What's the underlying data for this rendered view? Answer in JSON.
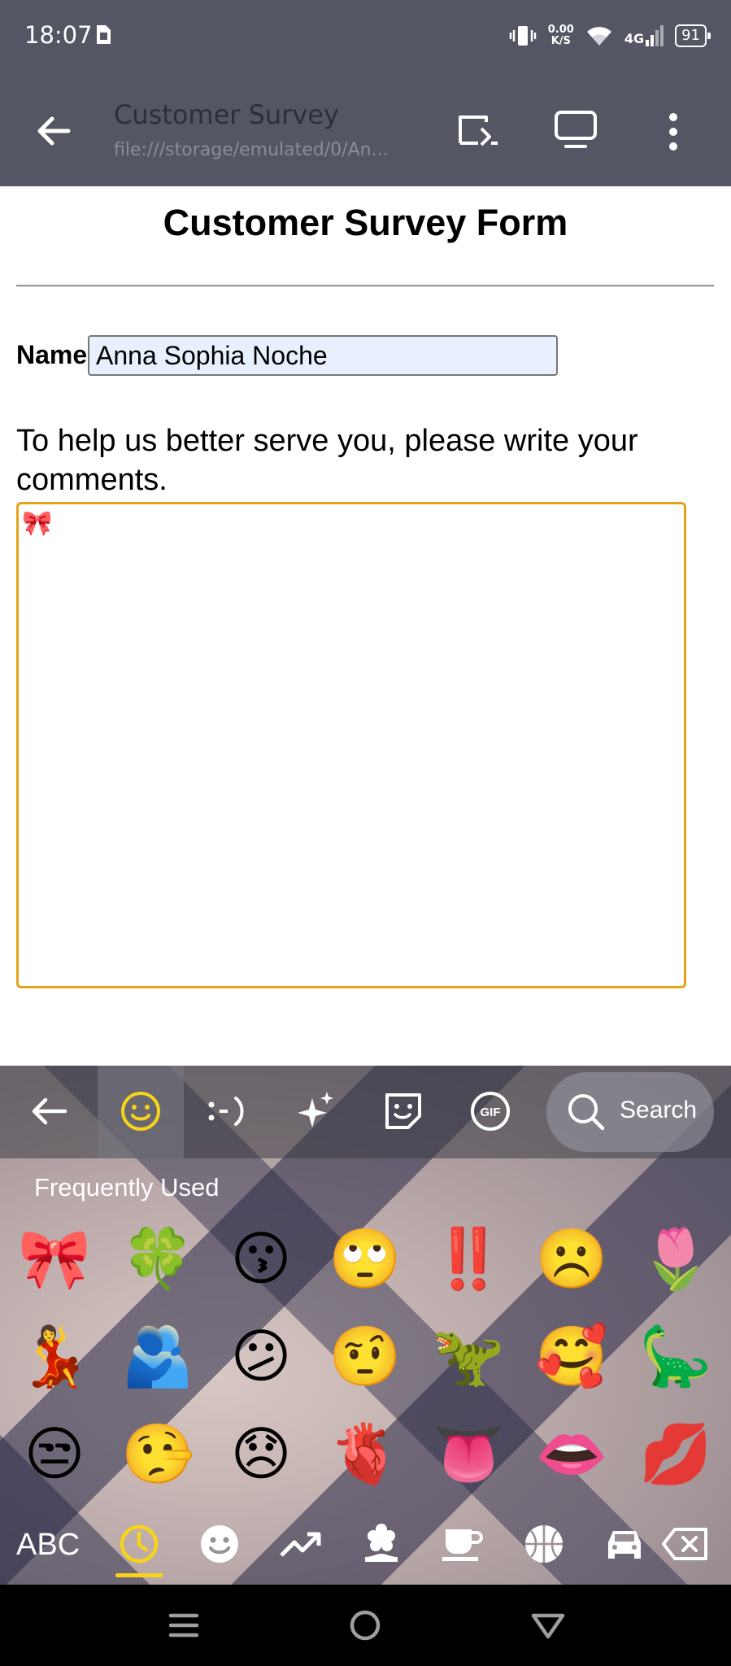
{
  "status_bar": {
    "time": "18:07",
    "net_speed_value": "0.00",
    "net_speed_unit": "K/S",
    "network": "4G",
    "battery": "91"
  },
  "app_bar": {
    "title": "Customer Survey",
    "subtitle": "file:///storage/emulated/0/An..."
  },
  "form": {
    "title": "Customer Survey Form",
    "name_label": "Name",
    "name_value": "Anna Sophia Noche",
    "comments_prompt": "To help us better serve you, please write your comments.",
    "comments_value": "🎀"
  },
  "keyboard": {
    "search_label": "Search",
    "section_label": "Frequently Used",
    "abc_label": "ABC",
    "accent_color": "#f7d417",
    "emoji_rows": [
      [
        "🎀",
        "🍀",
        "😗",
        "🙄",
        "‼️",
        "☹️",
        "🌷"
      ],
      [
        "💃",
        "🫂",
        "😕",
        "🤨",
        "🦖",
        "🥰",
        "🦕"
      ],
      [
        "😒",
        "🤥",
        "😞",
        "🫀",
        "👅",
        "👄",
        "💋"
      ]
    ]
  },
  "colors": {
    "app_bar_bg": "#545663",
    "textarea_border": "#e6a11a",
    "input_bg": "#e8f0fe"
  }
}
